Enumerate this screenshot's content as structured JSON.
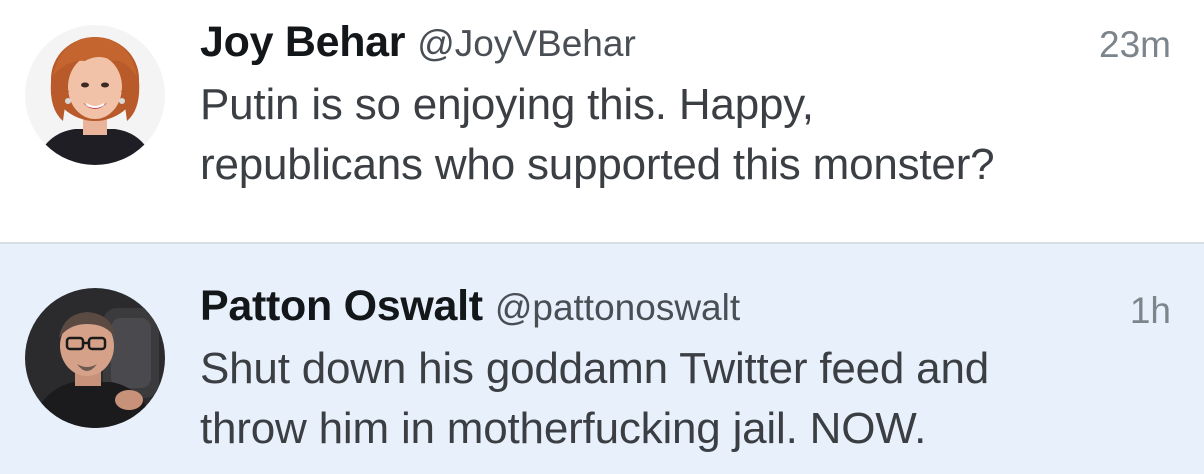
{
  "tweets": [
    {
      "display_name": "Joy Behar",
      "handle": "@JoyVBehar",
      "timestamp": "23m",
      "text_lines": [
        "Putin is so enjoying this. Happy,",
        "republicans who supported this monster?"
      ],
      "avatar_icon": "avatar-photo-woman-red-hair",
      "background": "#ffffff"
    },
    {
      "display_name": "Patton Oswalt",
      "handle": "@pattonoswalt",
      "timestamp": "1h",
      "text_lines": [
        "Shut down his goddamn Twitter feed and",
        "throw him in motherfucking jail. NOW."
      ],
      "avatar_icon": "avatar-photo-man-glasses",
      "background": "#e8f1fb"
    }
  ]
}
